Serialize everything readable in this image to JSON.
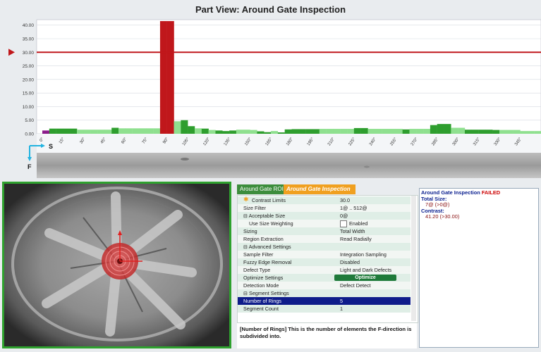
{
  "part_view": {
    "title": "Part View:  Around Gate Inspection",
    "direction_s": "S",
    "direction_f": "F"
  },
  "chart_data": {
    "type": "bar",
    "ylim": [
      0,
      42
    ],
    "yticks": [
      "0.00",
      "5.00",
      "10.00",
      "15.00",
      "20.00",
      "25.00",
      "30.00",
      "35.00",
      "40.00"
    ],
    "threshold": 30.0,
    "xticks": [
      "0°",
      "15°",
      "30°",
      "45°",
      "60°",
      "75°",
      "90°",
      "105°",
      "120°",
      "135°",
      "150°",
      "165°",
      "180°",
      "195°",
      "210°",
      "225°",
      "240°",
      "255°",
      "270°",
      "285°",
      "300°",
      "315°",
      "330°",
      "345°"
    ],
    "categories_deg": [
      0,
      5,
      10,
      15,
      20,
      25,
      30,
      35,
      40,
      45,
      50,
      55,
      60,
      65,
      70,
      75,
      80,
      85,
      90,
      95,
      100,
      105,
      110,
      115,
      120,
      125,
      130,
      135,
      140,
      145,
      150,
      155,
      160,
      165,
      170,
      175,
      180,
      185,
      190,
      195,
      200,
      205,
      210,
      215,
      220,
      225,
      230,
      235,
      240,
      245,
      250,
      255,
      260,
      265,
      270,
      275,
      280,
      285,
      290,
      295,
      300,
      305,
      310,
      315,
      320,
      325,
      330,
      335,
      340,
      345,
      350,
      355
    ],
    "values": [
      1.2,
      1.9,
      1.9,
      1.9,
      1.9,
      1.5,
      1.5,
      1.5,
      1.5,
      1.5,
      2.2,
      2.0,
      2.0,
      2.0,
      2.0,
      2.0,
      2.0,
      41.5,
      41.5,
      4.6,
      5.0,
      2.8,
      2.0,
      1.9,
      1.4,
      1.2,
      1.0,
      1.2,
      1.5,
      1.5,
      1.4,
      0.9,
      0.6,
      1.0,
      0.5,
      1.6,
      1.7,
      1.7,
      1.7,
      1.7,
      1.8,
      1.8,
      1.8,
      1.8,
      1.8,
      2.1,
      2.1,
      1.8,
      1.8,
      1.8,
      1.8,
      1.8,
      1.6,
      1.8,
      1.8,
      1.8,
      3.2,
      3.6,
      3.6,
      2.2,
      2.2,
      1.5,
      1.5,
      1.5,
      1.5,
      1.4,
      1.4,
      1.4,
      1.4,
      1.0,
      1.0,
      1.0
    ],
    "bar_colors": [
      "#8a1a8a",
      "#2e9e2e",
      "#2e9e2e",
      "#2e9e2e",
      "#2e9e2e",
      "#8fe08f",
      "#8fe08f",
      "#8fe08f",
      "#8fe08f",
      "#8fe08f",
      "#2e9e2e",
      "#8fe08f",
      "#8fe08f",
      "#8fe08f",
      "#8fe08f",
      "#8fe08f",
      "#8fe08f",
      "#c0171b",
      "#c0171b",
      "#8fe08f",
      "#2e9e2e",
      "#2e9e2e",
      "#8fe08f",
      "#2e9e2e",
      "#8fe08f",
      "#2e9e2e",
      "#2e9e2e",
      "#2e9e2e",
      "#8fe08f",
      "#8fe08f",
      "#8fe08f",
      "#2e9e2e",
      "#2e9e2e",
      "#8fe08f",
      "#2e9e2e",
      "#2e9e2e",
      "#2e9e2e",
      "#2e9e2e",
      "#2e9e2e",
      "#2e9e2e",
      "#8fe08f",
      "#8fe08f",
      "#8fe08f",
      "#8fe08f",
      "#8fe08f",
      "#2e9e2e",
      "#2e9e2e",
      "#8fe08f",
      "#8fe08f",
      "#8fe08f",
      "#8fe08f",
      "#8fe08f",
      "#2e9e2e",
      "#8fe08f",
      "#8fe08f",
      "#8fe08f",
      "#2e9e2e",
      "#2e9e2e",
      "#2e9e2e",
      "#8fe08f",
      "#8fe08f",
      "#2e9e2e",
      "#2e9e2e",
      "#2e9e2e",
      "#2e9e2e",
      "#2e9e2e",
      "#8fe08f",
      "#8fe08f",
      "#8fe08f",
      "#8fe08f",
      "#8fe08f",
      "#8fe08f"
    ],
    "threshold_color": "#c0171b",
    "grid": true
  },
  "tabs": [
    {
      "label": "Around Gate ROI"
    },
    {
      "label": "Around Gate Inspection"
    }
  ],
  "properties": [
    {
      "label": "Contrast Limits",
      "value": "30.0",
      "style": "odd",
      "icon": "star-icon"
    },
    {
      "label": "Size Filter",
      "value": "1@ .. 512@",
      "style": "even"
    },
    {
      "label": "⊟ Acceptable Size",
      "value": "0@",
      "style": "odd"
    },
    {
      "label": "Use Size Weighting",
      "value": "Enabled",
      "style": "even",
      "checkbox": true,
      "indent": true
    },
    {
      "label": "Sizing",
      "value": "Total Width",
      "style": "odd"
    },
    {
      "label": "Region Extraction",
      "value": "Read Radially",
      "style": "even"
    },
    {
      "label": "⊟ Advanced Settings",
      "value": "",
      "style": "odd"
    },
    {
      "label": "Sample Filter",
      "value": "Integration Sampling",
      "style": "even"
    },
    {
      "label": "Fuzzy Edge Removal",
      "value": "Disabled",
      "style": "odd"
    },
    {
      "label": "Defect Type",
      "value": "Light and Dark Defects",
      "style": "even"
    },
    {
      "label": "Optimize Settings",
      "value": "",
      "style": "odd",
      "button": "Optimize"
    },
    {
      "label": "Detection Mode",
      "value": "Defect Detect",
      "style": "even"
    },
    {
      "label": "⊟ Segment Settings",
      "value": "",
      "style": "odd"
    },
    {
      "label": "Number of Rings",
      "value": "5",
      "style": "sel"
    },
    {
      "label": "Segment Count",
      "value": "1",
      "style": "odd"
    }
  ],
  "description": "[Number of Rings] This is the number of elements the F-direction is subdivided into.",
  "results": {
    "title": "Around Gate Inspection",
    "status": "FAILED",
    "total_size_label": "Total Size:",
    "total_size_value": "7@ (>0@)",
    "contrast_label": "Contrast:",
    "contrast_value": "41.20 (>30.00)"
  }
}
